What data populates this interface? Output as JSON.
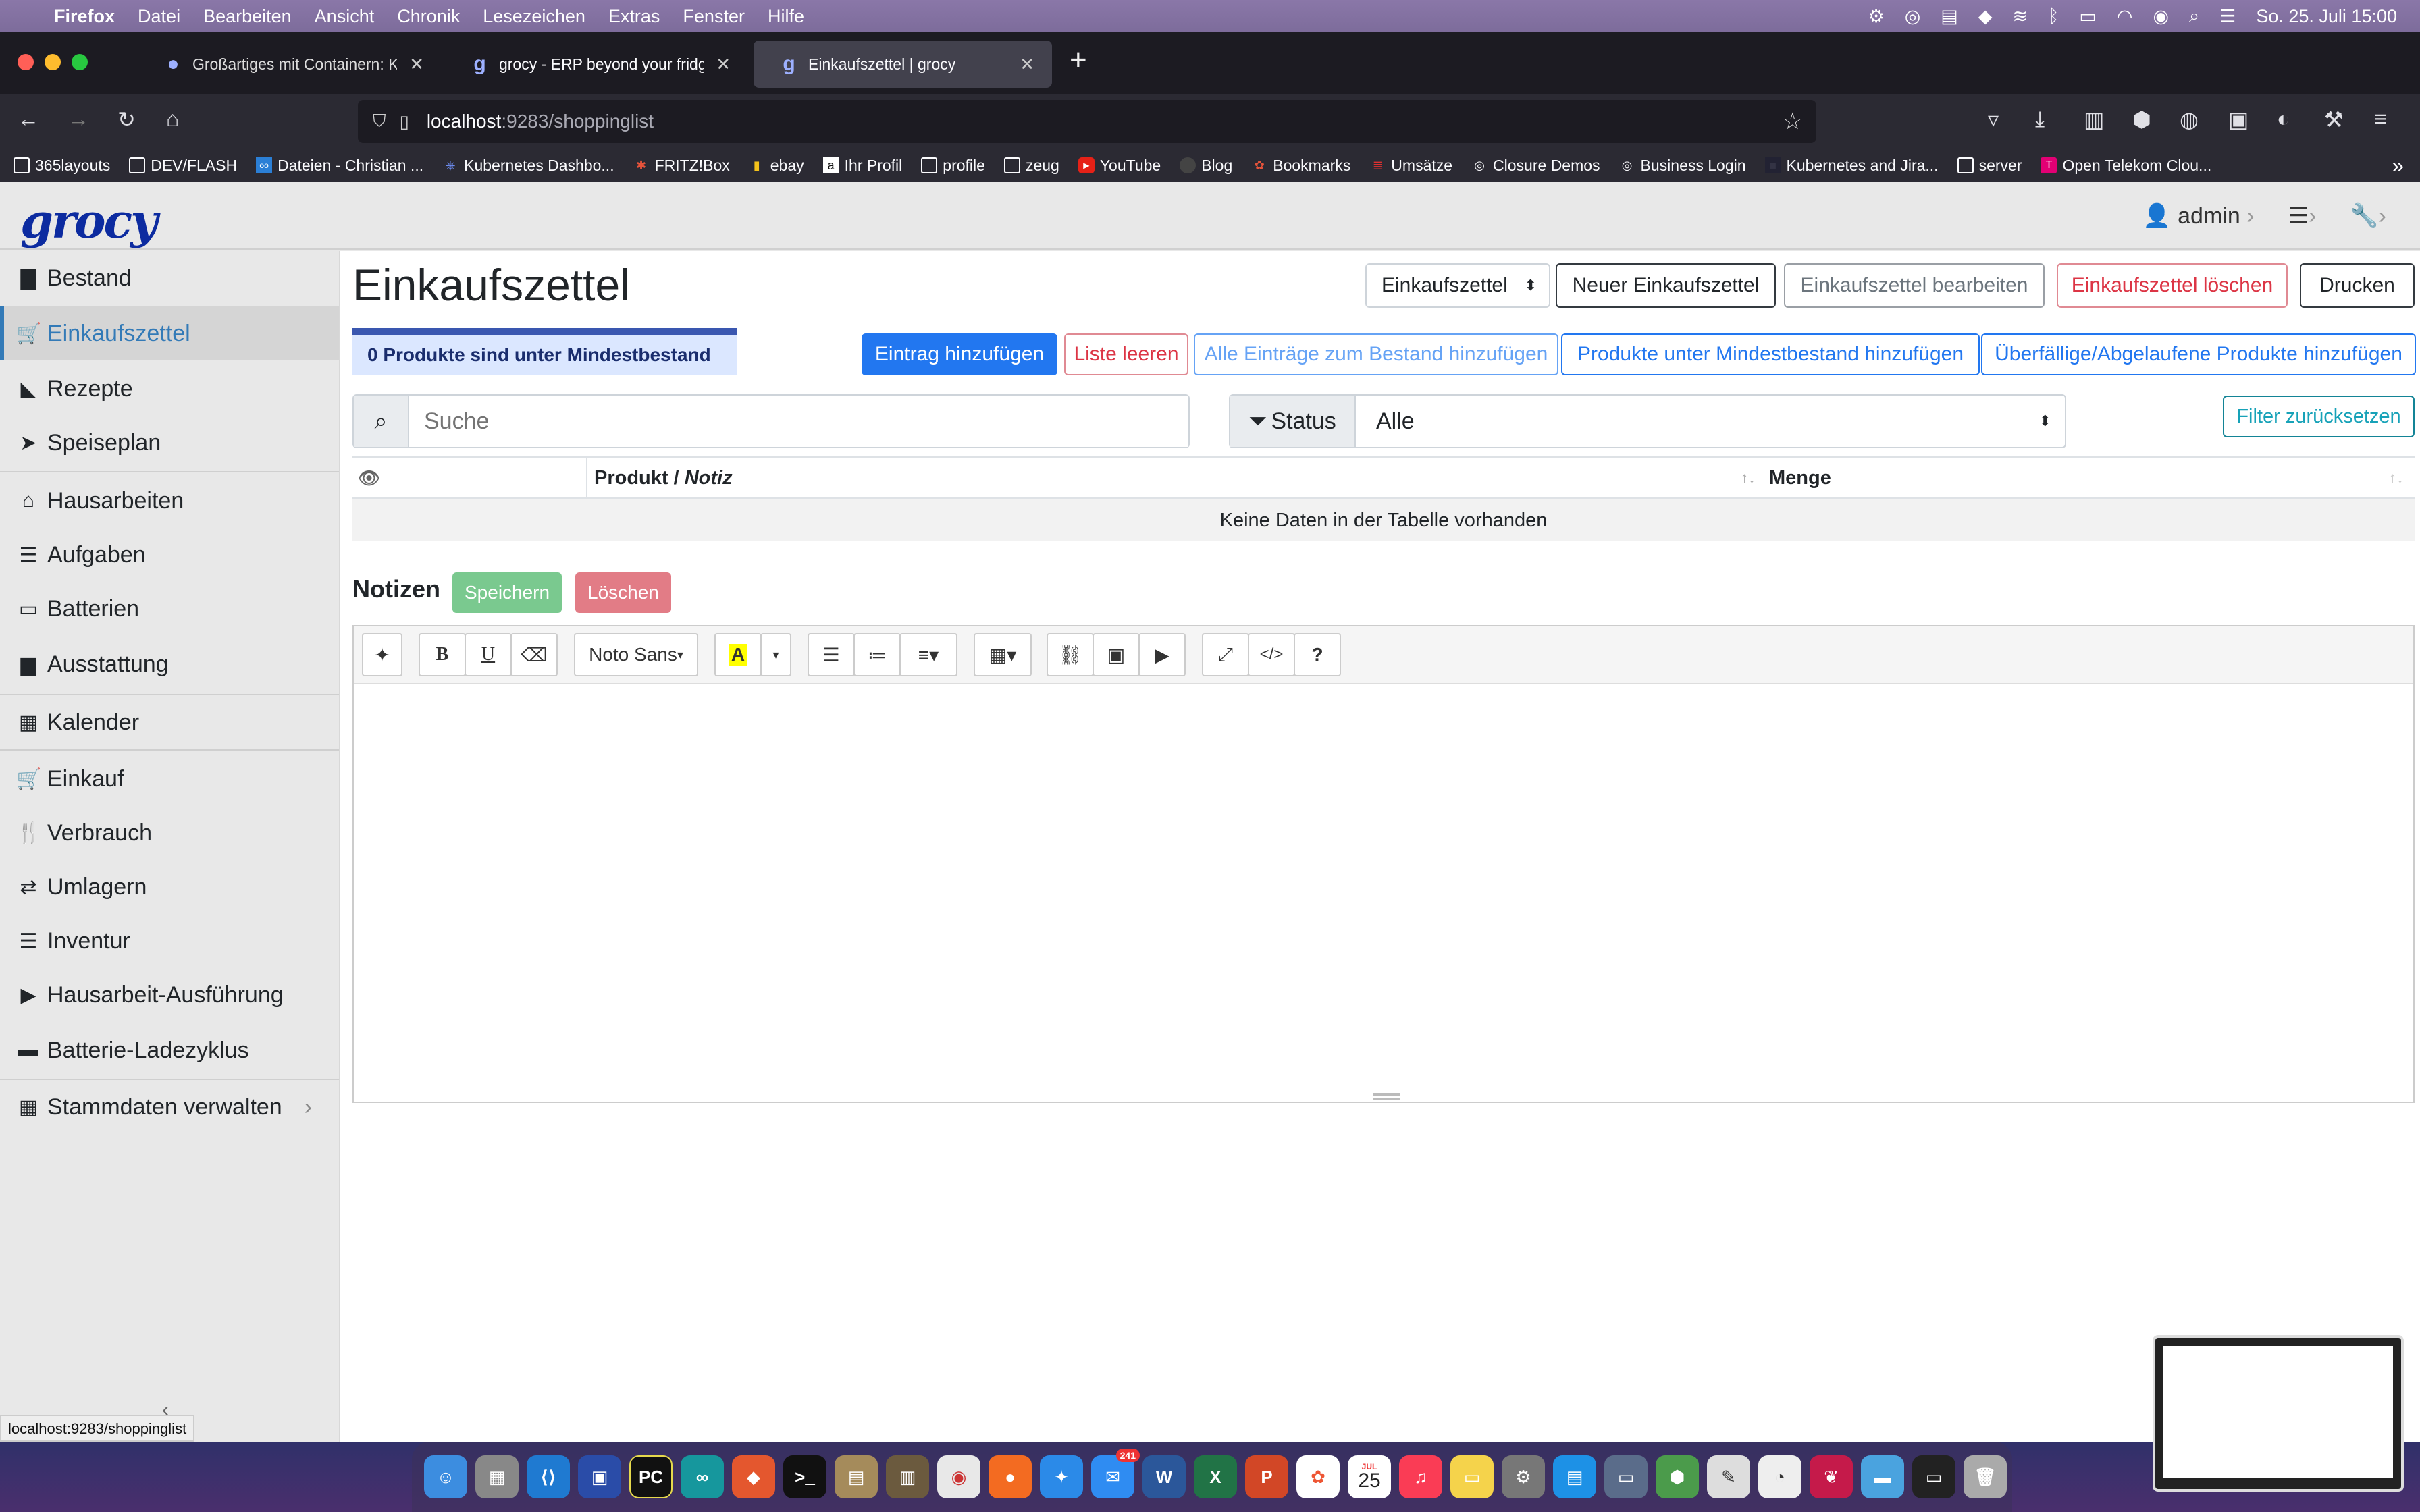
{
  "menubar": {
    "app": "Firefox",
    "items": [
      "Datei",
      "Bearbeiten",
      "Ansicht",
      "Chronik",
      "Lesezeichen",
      "Extras",
      "Fenster",
      "Hilfe"
    ],
    "clock": "So. 25. Juli  15:00"
  },
  "tabs": [
    {
      "title": "Großartiges mit Containern: Kü",
      "favicon": "github-icon"
    },
    {
      "title": "grocy - ERP beyond your fridge",
      "favicon": "grocy-icon"
    },
    {
      "title": "Einkaufszettel | grocy",
      "favicon": "grocy-icon"
    }
  ],
  "url": {
    "host": "localhost",
    "rest": ":9283/shoppinglist"
  },
  "bookmarks": [
    "365layouts",
    "DEV/FLASH",
    "Dateien - Christian ...",
    "Kubernetes Dashbo...",
    "FRITZ!Box",
    "ebay",
    "Ihr Profil",
    "profile",
    "zeug",
    "YouTube",
    "Blog",
    "Bookmarks",
    "Umsätze",
    "Closure Demos",
    "Business Login",
    "Kubernetes and Jira...",
    "server",
    "Open Telekom Clou..."
  ],
  "app": {
    "logo": "grocy",
    "user": "admin"
  },
  "sidebar": {
    "items": [
      {
        "label": "Bestand"
      },
      {
        "label": "Einkaufszettel"
      },
      {
        "label": "Rezepte"
      },
      {
        "label": "Speiseplan"
      },
      {
        "label": "Hausarbeiten"
      },
      {
        "label": "Aufgaben"
      },
      {
        "label": "Batterien"
      },
      {
        "label": "Ausstattung"
      },
      {
        "label": "Kalender"
      },
      {
        "label": "Einkauf"
      },
      {
        "label": "Verbrauch"
      },
      {
        "label": "Umlagern"
      },
      {
        "label": "Inventur"
      },
      {
        "label": "Hausarbeit-Ausführung"
      },
      {
        "label": "Batterie-Ladezyklus"
      },
      {
        "label": "Stammdaten verwalten"
      }
    ]
  },
  "page": {
    "title": "Einkaufszettel",
    "list_select": "Einkaufszettel",
    "buttons": {
      "new_list": "Neuer Einkaufszettel",
      "edit_list": "Einkaufszettel bearbeiten",
      "delete_list": "Einkaufszettel löschen",
      "print": "Drucken",
      "add_entry": "Eintrag hinzufügen",
      "clear_list": "Liste leeren",
      "add_all_to_stock": "Alle Einträge zum Bestand hinzufügen",
      "add_below_min": "Produkte unter Mindestbestand hinzufügen",
      "add_overdue": "Überfällige/Abgelaufene Produkte hinzufügen",
      "reset_filter": "Filter zurücksetzen"
    },
    "alert": "0 Produkte sind unter Mindestbestand",
    "search": {
      "placeholder": "Suche"
    },
    "status_filter": {
      "label": "Status",
      "value": "Alle"
    },
    "table": {
      "col_product": "Produkt / ",
      "col_note": "Notiz",
      "col_amount": "Menge",
      "empty": "Keine Daten in der Tabelle vorhanden"
    },
    "notes": {
      "title": "Notizen",
      "save": "Speichern",
      "delete": "Löschen",
      "font": "Noto Sans"
    }
  },
  "statusbar": {
    "link": "localhost:9283/shoppinglist"
  },
  "dock": {
    "calendar_day": "25",
    "calendar_month": "JUL",
    "mail_badge": "241"
  },
  "colors": {
    "accent": "#337ab7",
    "primary": "#2277f0",
    "danger": "#dc3545",
    "success": "#7ac98f",
    "logo": "#0c2ba0"
  }
}
